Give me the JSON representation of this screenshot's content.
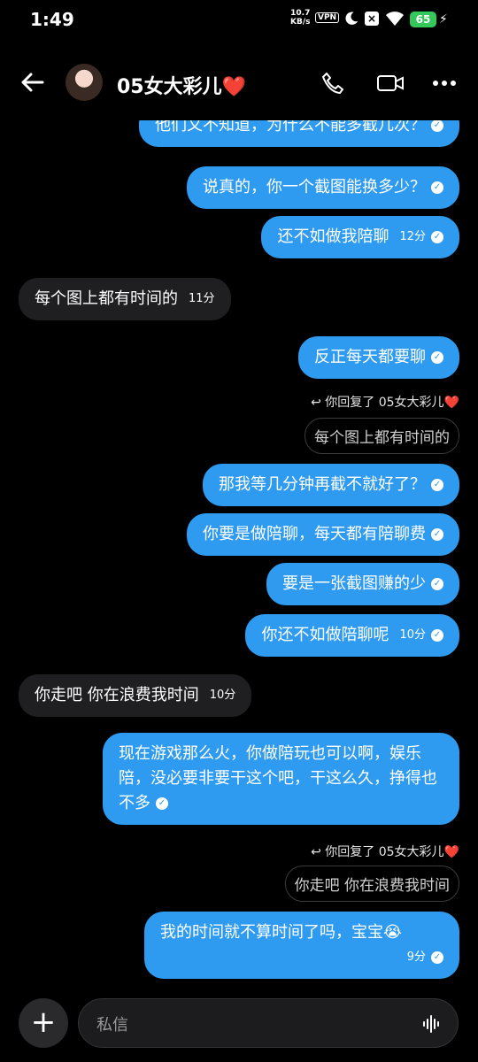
{
  "status": {
    "time": "1:49",
    "net_speed_top": "10.7",
    "net_speed_bottom": "KB/s",
    "vpn": "VPN",
    "battery": "65"
  },
  "header": {
    "contact_name": "05女大彩儿❤️"
  },
  "messages": [
    {
      "text": "他们又不知道，为什么不能多截几次？"
    },
    {
      "text": "说真的，你一个截图能换多少？"
    },
    {
      "text": "还不如做我陪聊",
      "time": "12分"
    },
    {
      "text": "每个图上都有时间的",
      "time": "11分"
    },
    {
      "text": "反正每天都要聊"
    },
    {
      "reply_label": "你回复了 05女大彩儿❤️",
      "quote": "每个图上都有时间的"
    },
    {
      "text": "那我等几分钟再截不就好了？"
    },
    {
      "text": "你要是做陪聊，每天都有陪聊费"
    },
    {
      "text": "要是一张截图赚的少"
    },
    {
      "text": "你还不如做陪聊呢",
      "time": "10分"
    },
    {
      "text": "你走吧 你在浪费我时间",
      "time": "10分"
    },
    {
      "text": "现在游戏那么火，你做陪玩也可以啊，娱乐陪，没必要非要干这个吧，干这么久，挣得也不多"
    },
    {
      "reply_label": "你回复了 05女大彩儿❤️",
      "quote": "你走吧 你在浪费我时间"
    },
    {
      "text": "我的时间就不算时间了吗，宝宝😭",
      "time": "9分"
    }
  ],
  "composer": {
    "placeholder": "私信"
  }
}
